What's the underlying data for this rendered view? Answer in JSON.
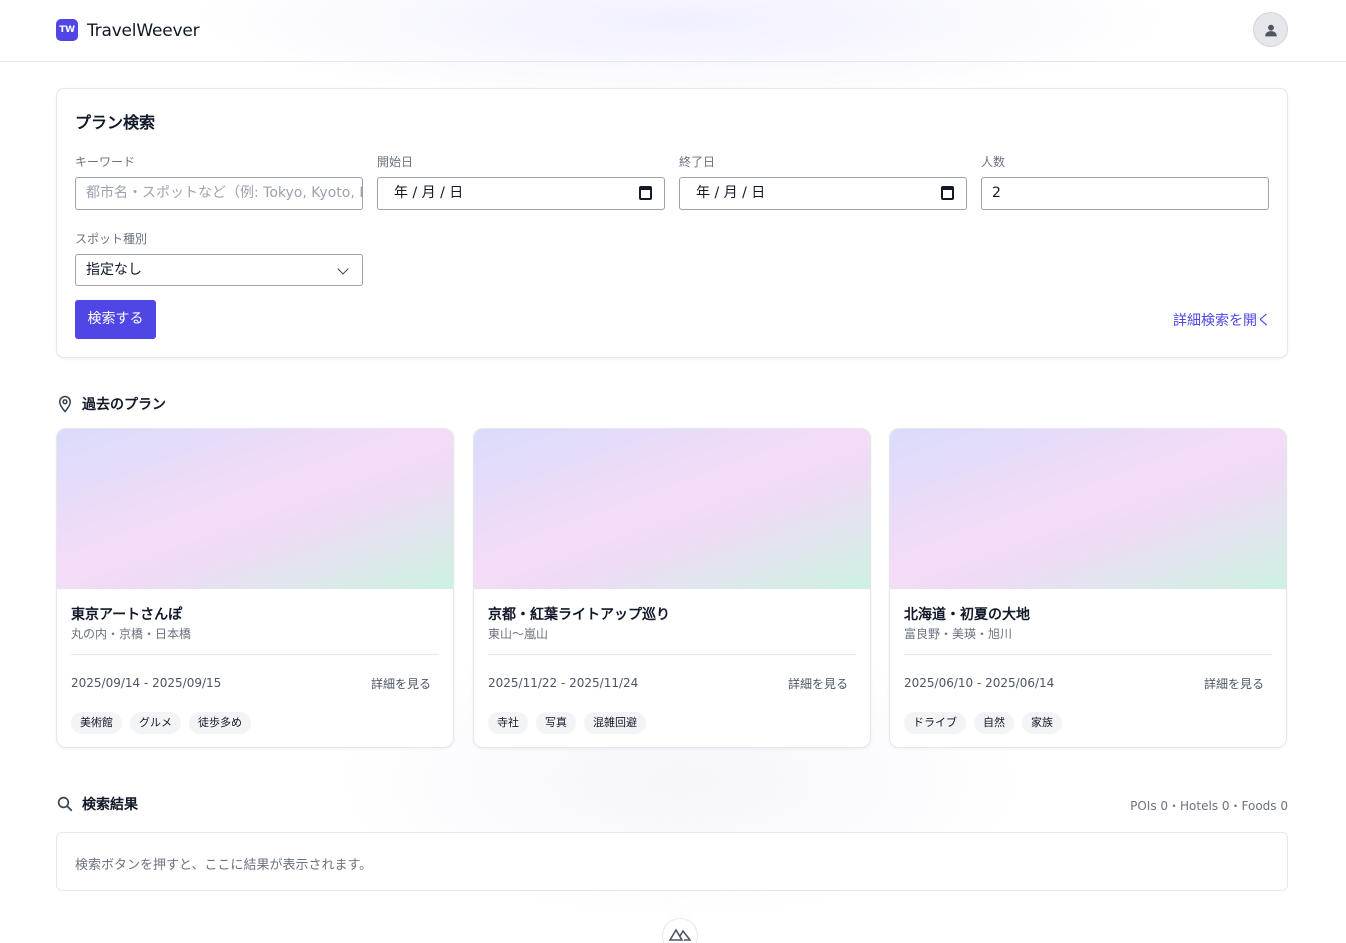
{
  "header": {
    "logo_badge": "TW",
    "brand": "TravelWeever"
  },
  "search": {
    "title": "プラン検索",
    "keyword_label": "キーワード",
    "keyword_placeholder": "都市名・スポットなど（例: Tokyo, Kyoto, Pa",
    "start_label": "開始日",
    "start_value": "年 / 月 / 日",
    "end_label": "終了日",
    "end_value": "年 / 月 / 日",
    "people_label": "人数",
    "people_value": "2",
    "spot_label": "スポット種別",
    "spot_value": "指定なし",
    "search_button": "検索する",
    "advanced_link": "詳細検索を開く"
  },
  "past_plans": {
    "heading": "過去のプラン",
    "items": [
      {
        "title": "東京アートさんぽ",
        "subtitle": "丸の内・京橋・日本橋",
        "dates": "2025/09/14 - 2025/09/15",
        "detail": "詳細を見る",
        "tags": [
          "美術館",
          "グルメ",
          "徒歩多め"
        ]
      },
      {
        "title": "京都・紅葉ライトアップ巡り",
        "subtitle": "東山〜嵐山",
        "dates": "2025/11/22 - 2025/11/24",
        "detail": "詳細を見る",
        "tags": [
          "寺社",
          "写真",
          "混雑回避"
        ]
      },
      {
        "title": "北海道・初夏の大地",
        "subtitle": "富良野・美瑛・旭川",
        "dates": "2025/06/10 - 2025/06/14",
        "detail": "詳細を見る",
        "tags": [
          "ドライブ",
          "自然",
          "家族"
        ]
      }
    ]
  },
  "results": {
    "heading": "検索結果",
    "counts": "POIs 0・Hotels 0・Foods 0",
    "empty_message": "検索ボタンを押すと、ここに結果が表示されます。"
  },
  "colors": {
    "accent": "#4f46e5",
    "border": "#e5e7eb",
    "muted_text": "#6b7280"
  },
  "icons": {
    "user": "user-icon",
    "pin": "map-pin-icon",
    "search": "search-icon",
    "calendar": "calendar-icon",
    "chevron": "chevron-down-icon",
    "devtools": "nuxt-icon"
  }
}
